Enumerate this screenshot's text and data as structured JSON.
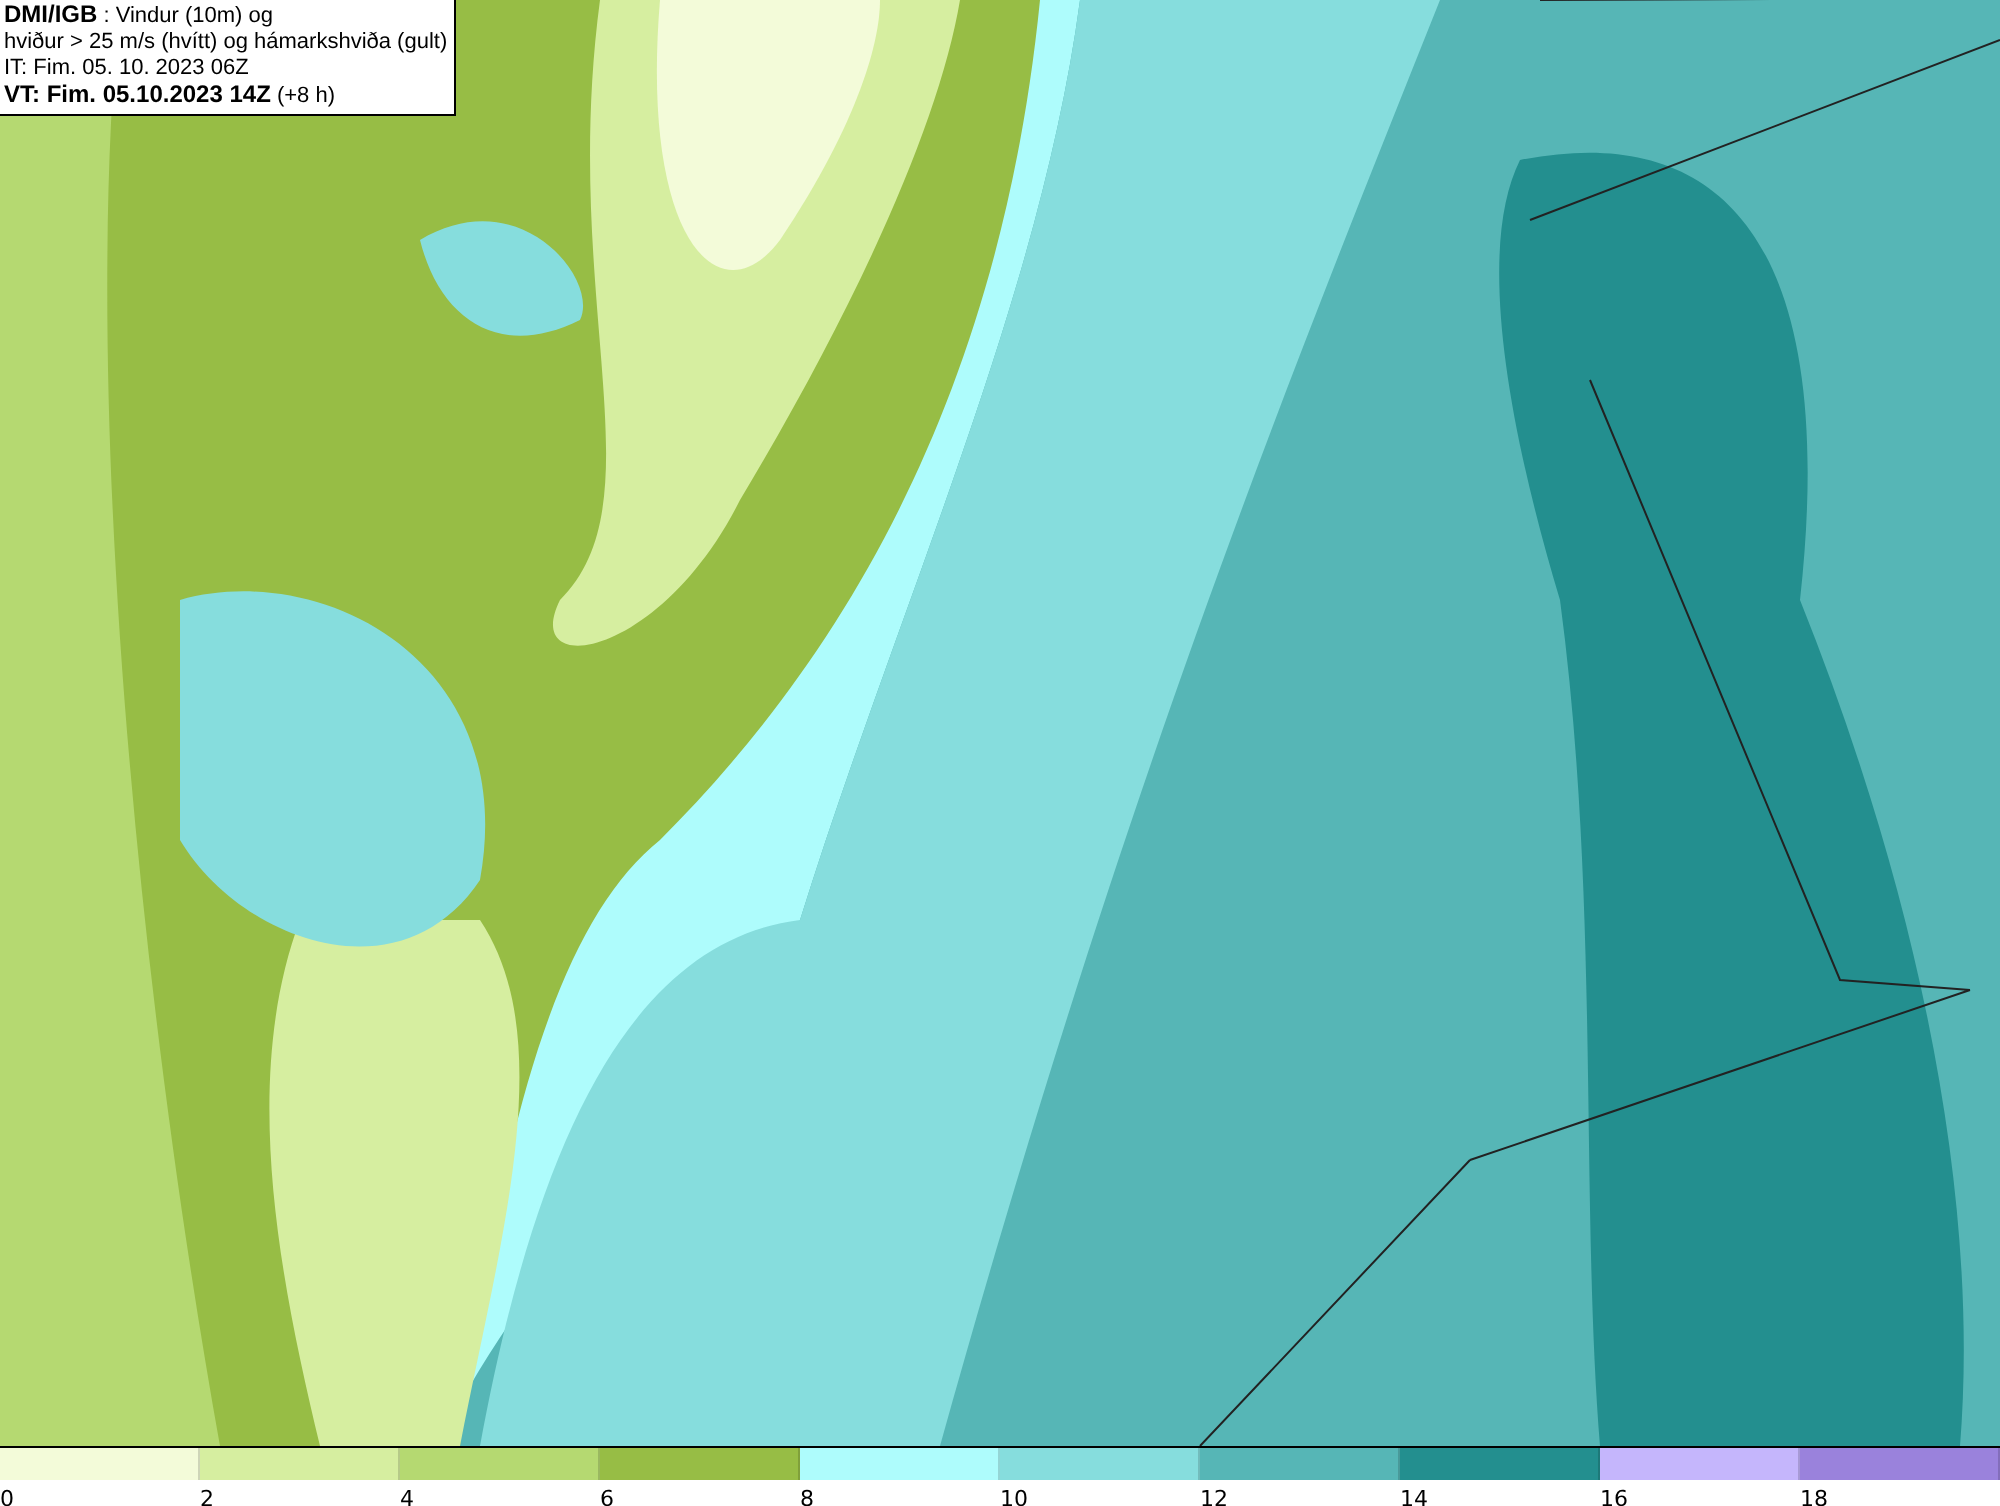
{
  "title_box": {
    "lines": [
      "**DMI/IGB** : Vindur (10m) og",
      "hviður > 25 m/s (hvítt) og hámarkshviða (gult)",
      "IT: Fim. 05. 10. 2023 06Z",
      "**VT: Fim. 05.10.2023 14Z** (+8 h)"
    ]
  },
  "legend": [
    {
      "label": "0",
      "color": "#f3fbd9"
    },
    {
      "label": "2",
      "color": "#d6eea0"
    },
    {
      "label": "4",
      "color": "#b5d971"
    },
    {
      "label": "6",
      "color": "#97bd45"
    },
    {
      "label": "8",
      "color": "#aefcfc"
    },
    {
      "label": "10",
      "color": "#86dddd"
    },
    {
      "label": "12",
      "color": "#56b6b6"
    },
    {
      "label": "14",
      "color": "#238f8f"
    },
    {
      "label": "16",
      "color": "#c5b6fc"
    },
    {
      "label": "18",
      "color": "#9a82dc"
    }
  ]
}
